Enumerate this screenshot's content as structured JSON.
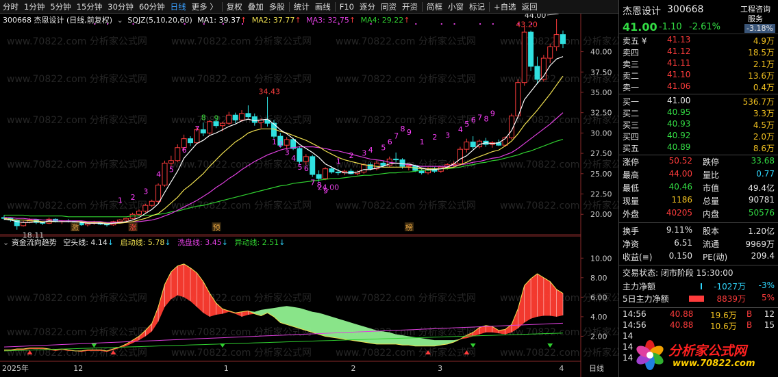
{
  "toolbar": {
    "items": [
      "分时",
      "1分钟",
      "5分钟",
      "15分钟",
      "30分钟",
      "60分钟",
      "日线",
      "更多 〉",
      "复权",
      "叠加",
      "多股",
      "统计",
      "画线",
      "F10",
      "逐分",
      "同资",
      "开资",
      "简框",
      "小窗",
      "标记",
      "+自选",
      "返回"
    ],
    "active": "日线"
  },
  "main_legend": {
    "code_name": "300668 杰恩设计 (日线,前复权)",
    "indicator": "SQJZ(5,10,20,60)",
    "ma1": "MA1: 39.37",
    "ma2": "MA2: 37.77",
    "ma3": "MA3: 32.75",
    "ma4": "MA4: 29.22",
    "colors": {
      "ma1": "#ffffff",
      "ma2": "#f0e050",
      "ma3": "#e040e0",
      "ma4": "#30d030"
    }
  },
  "sub_legend": {
    "name": "资金流向趋势",
    "l1": "空头线: 4.14",
    "l2": "启动线: 5.78",
    "l3": "洗盘线: 3.45",
    "l4": "异动线: 2.51"
  },
  "main_axis": [
    "40.00",
    "37.50",
    "35.00",
    "32.50",
    "30.00",
    "27.50",
    "25.00",
    "22.50",
    "20.00"
  ],
  "sub_axis": [
    "10.00",
    "8.00",
    "6.00",
    "4.00",
    "2.00"
  ],
  "price_labels": {
    "high1": "34.43",
    "low1": "24.00",
    "start": "18.11",
    "high2": "44.00",
    "cur": "43.20"
  },
  "digit_labels": [
    "1",
    "2",
    "3",
    "4",
    "5",
    "6",
    "7",
    "8",
    "9",
    "1",
    "2",
    "3",
    "4",
    "5",
    "6",
    "7",
    "8",
    "9",
    "1",
    "2",
    "3",
    "4",
    "5",
    "6",
    "7",
    "8",
    "9",
    "1",
    "2",
    "3",
    "4",
    "5",
    "6",
    "7",
    "8",
    "9"
  ],
  "tags": [
    "激",
    "涨",
    "预",
    "榜"
  ],
  "date_axis": [
    "2025年",
    "12",
    "1",
    "2",
    "3",
    "4"
  ],
  "period_label": "日线",
  "watermark": "www.70822.com 分析家公式网",
  "quote": {
    "name": "杰恩设计",
    "code": "300668",
    "price": "41.00",
    "change": "-1.10",
    "pct": "-2.61%",
    "sector": "工程咨询",
    "sector2": "服务",
    "sector_pct": "-3.18%",
    "asks": [
      {
        "label": "卖五 ¥",
        "price": "41.13",
        "vol": "4.9万"
      },
      {
        "label": "卖四",
        "price": "41.12",
        "vol": "18.5万"
      },
      {
        "label": "卖三",
        "price": "41.11",
        "vol": "2.1万"
      },
      {
        "label": "卖二",
        "price": "41.10",
        "vol": "13.6万"
      },
      {
        "label": "卖一",
        "price": "41.06",
        "vol": "0.4万"
      }
    ],
    "bids": [
      {
        "label": "买一",
        "price": "41.00",
        "vol": "536.7万"
      },
      {
        "label": "买二",
        "price": "40.95",
        "vol": "3.3万"
      },
      {
        "label": "买三",
        "price": "40.93",
        "vol": "4.5万"
      },
      {
        "label": "买四",
        "price": "40.92",
        "vol": "2.0万"
      },
      {
        "label": "买五",
        "price": "40.89",
        "vol": "8.6万"
      }
    ],
    "stats": [
      {
        "k1": "涨停",
        "v1": "50.52",
        "c1": "red",
        "k2": "跌停",
        "v2": "33.68",
        "c2": "green"
      },
      {
        "k1": "最高",
        "v1": "44.00",
        "c1": "red",
        "k2": "量比",
        "v2": "0.77",
        "c2": "cyan"
      },
      {
        "k1": "最低",
        "v1": "40.46",
        "c1": "green",
        "k2": "市值",
        "v2": "49.4亿",
        "c2": "white"
      },
      {
        "k1": "现量",
        "v1": "1186",
        "c1": "yellow",
        "k2": "总量",
        "v2": "90781",
        "c2": "white"
      },
      {
        "k1": "外盘",
        "v1": "40205",
        "c1": "red",
        "k2": "内盘",
        "v2": "50576",
        "c2": "green"
      },
      {
        "k1": "换手",
        "v1": "9.11%",
        "c1": "white",
        "k2": "股本",
        "v2": "1.20亿",
        "c2": "white"
      },
      {
        "k1": "净资",
        "v1": "6.51",
        "c1": "white",
        "k2": "流通",
        "v2": "9969万",
        "c2": "white"
      },
      {
        "k1": "收益(≡)",
        "v1": "0.150",
        "c1": "white",
        "k2": "PE(动)",
        "v2": "209.4",
        "c2": "white"
      }
    ],
    "trade_status": "交易状态: 闭市阶段 15:30:00",
    "flow": [
      {
        "label": "主力净额",
        "val": "-1027万",
        "pct": "-3%"
      },
      {
        "label": "5日主力净额",
        "val": "8839万",
        "pct": "5%"
      }
    ],
    "ticks": [
      {
        "t": "14:56",
        "p": "40.88",
        "v": "19.6万",
        "s": "B",
        "n": "12"
      },
      {
        "t": "14:56",
        "p": "40.88",
        "v": "10.6万",
        "s": "B",
        "n": "15"
      },
      {
        "t": "14",
        "p": "",
        "v": "",
        "s": "",
        "n": ""
      },
      {
        "t": "14",
        "p": "",
        "v": "",
        "s": "",
        "n": ""
      },
      {
        "t": "14",
        "p": "",
        "v": "",
        "s": "",
        "n": ""
      }
    ],
    "logo": {
      "cn": "分析家公式网",
      "url": "www.70822.com"
    }
  },
  "chart_data": {
    "type": "candlestick",
    "price_range": [
      18,
      44
    ],
    "sub_range": [
      0,
      11
    ],
    "candles": [
      [
        19.6,
        19.9,
        19.3,
        19.5
      ],
      [
        19.5,
        19.6,
        19.1,
        19.3
      ],
      [
        19.3,
        19.4,
        18.11,
        18.6
      ],
      [
        18.6,
        19.2,
        18.5,
        19.0
      ],
      [
        19.0,
        19.5,
        18.9,
        19.3
      ],
      [
        19.3,
        19.4,
        18.8,
        19.0
      ],
      [
        19.0,
        19.1,
        18.7,
        18.9
      ],
      [
        18.9,
        19.6,
        18.8,
        19.4
      ],
      [
        19.4,
        19.5,
        19.0,
        19.1
      ],
      [
        19.1,
        19.3,
        18.8,
        19.2
      ],
      [
        19.2,
        19.4,
        19.0,
        19.1
      ],
      [
        19.1,
        19.2,
        18.8,
        19.0
      ],
      [
        19.0,
        19.1,
        18.6,
        18.7
      ],
      [
        18.7,
        19.0,
        18.5,
        18.9
      ],
      [
        18.9,
        19.2,
        18.7,
        19.0
      ],
      [
        19.0,
        19.1,
        18.7,
        18.8
      ],
      [
        18.8,
        19.0,
        18.5,
        18.7
      ],
      [
        18.7,
        19.2,
        18.6,
        19.1
      ],
      [
        19.1,
        19.4,
        18.9,
        19.3
      ],
      [
        19.3,
        19.6,
        19.1,
        19.5
      ],
      [
        19.5,
        20.2,
        19.4,
        20.0
      ],
      [
        20.0,
        20.6,
        19.8,
        20.4
      ],
      [
        20.4,
        21.3,
        20.2,
        21.1
      ],
      [
        21.1,
        21.8,
        20.9,
        21.6
      ],
      [
        21.6,
        23.8,
        21.4,
        23.6
      ],
      [
        23.6,
        26.6,
        23.4,
        26.3
      ],
      [
        26.3,
        27.2,
        25.9,
        26.6
      ],
      [
        26.6,
        28.6,
        26.4,
        28.2
      ],
      [
        28.2,
        29.8,
        27.8,
        29.3
      ],
      [
        29.3,
        29.6,
        28.4,
        28.8
      ],
      [
        28.8,
        30.8,
        28.6,
        30.4
      ],
      [
        30.4,
        31.3,
        29.6,
        30.0
      ],
      [
        30.0,
        31.6,
        29.8,
        31.4
      ],
      [
        31.4,
        31.8,
        30.6,
        30.9
      ],
      [
        30.9,
        31.4,
        30.2,
        31.2
      ],
      [
        31.2,
        32.6,
        31.0,
        32.2
      ],
      [
        32.2,
        32.5,
        31.2,
        31.6
      ],
      [
        31.6,
        32.8,
        31.4,
        32.4
      ],
      [
        32.4,
        33.4,
        31.8,
        32.0
      ],
      [
        32.0,
        32.4,
        30.9,
        31.3
      ],
      [
        31.3,
        31.8,
        30.6,
        31.6
      ],
      [
        31.6,
        34.43,
        30.8,
        31.2
      ],
      [
        31.2,
        31.6,
        29.3,
        29.6
      ],
      [
        29.6,
        30.0,
        28.2,
        28.5
      ],
      [
        28.5,
        29.5,
        28.0,
        29.2
      ],
      [
        29.2,
        29.4,
        27.9,
        28.1
      ],
      [
        28.1,
        28.4,
        26.2,
        26.5
      ],
      [
        26.5,
        27.4,
        26.1,
        27.1
      ],
      [
        27.1,
        27.3,
        24.6,
        24.9
      ],
      [
        24.9,
        25.4,
        24.0,
        24.4
      ],
      [
        24.4,
        25.8,
        24.2,
        25.6
      ],
      [
        25.6,
        25.9,
        25.0,
        25.2
      ],
      [
        25.2,
        25.6,
        24.8,
        25.1
      ],
      [
        25.1,
        25.5,
        24.8,
        25.3
      ],
      [
        25.3,
        25.6,
        24.9,
        25.0
      ],
      [
        25.0,
        25.4,
        24.8,
        25.2
      ],
      [
        25.2,
        26.3,
        25.0,
        26.1
      ],
      [
        26.1,
        26.4,
        25.4,
        25.6
      ],
      [
        25.6,
        26.6,
        25.4,
        26.3
      ],
      [
        26.3,
        26.6,
        25.8,
        26.0
      ],
      [
        26.0,
        27.1,
        25.8,
        26.8
      ],
      [
        26.8,
        27.6,
        26.4,
        26.7
      ],
      [
        26.7,
        26.9,
        25.6,
        25.9
      ],
      [
        25.9,
        26.2,
        25.4,
        26.0
      ],
      [
        26.0,
        26.1,
        25.2,
        25.4
      ],
      [
        25.4,
        25.6,
        24.9,
        25.1
      ],
      [
        25.1,
        25.8,
        24.9,
        25.6
      ],
      [
        25.6,
        25.8,
        25.1,
        25.3
      ],
      [
        25.3,
        25.9,
        25.1,
        25.8
      ],
      [
        25.8,
        26.3,
        25.5,
        26.1
      ],
      [
        26.1,
        26.5,
        25.8,
        26.2
      ],
      [
        26.2,
        28.3,
        26.0,
        28.0
      ],
      [
        28.0,
        29.3,
        27.6,
        28.9
      ],
      [
        28.9,
        29.6,
        28.0,
        28.3
      ],
      [
        28.3,
        29.2,
        28.1,
        29.0
      ],
      [
        29.0,
        29.4,
        28.3,
        28.6
      ],
      [
        28.6,
        29.0,
        28.2,
        28.8
      ],
      [
        28.8,
        29.2,
        28.4,
        28.5
      ],
      [
        28.5,
        29.6,
        28.3,
        29.4
      ],
      [
        29.4,
        32.4,
        29.2,
        32.1
      ],
      [
        32.1,
        36.6,
        31.8,
        36.2
      ],
      [
        36.2,
        43.2,
        35.8,
        42.4
      ],
      [
        42.4,
        42.6,
        37.6,
        38.2
      ],
      [
        38.2,
        39.4,
        36.0,
        36.6
      ],
      [
        36.6,
        39.6,
        36.3,
        39.2
      ],
      [
        39.2,
        41.0,
        38.6,
        40.6
      ],
      [
        40.6,
        44.0,
        40.1,
        42.1
      ],
      [
        42.1,
        42.6,
        40.46,
        41.0
      ]
    ],
    "ma1": [
      19.4,
      19.3,
      19.1,
      19.0,
      19.0,
      19.1,
      19.0,
      19.2,
      19.1,
      19.1,
      19.1,
      19.1,
      19.0,
      18.9,
      18.9,
      18.9,
      18.8,
      18.9,
      19.0,
      19.1,
      19.3,
      19.6,
      20.1,
      20.6,
      21.3,
      22.7,
      24.0,
      25.3,
      26.9,
      27.8,
      28.7,
      29.1,
      29.7,
      30.0,
      30.4,
      30.8,
      31.1,
      31.5,
      31.7,
      31.5,
      31.6,
      31.7,
      31.1,
      30.4,
      29.9,
      29.3,
      28.6,
      28.1,
      27.6,
      27.0,
      26.2,
      25.8,
      25.4,
      25.1,
      25.1,
      25.2,
      25.5,
      25.5,
      25.7,
      25.9,
      26.2,
      26.3,
      26.2,
      26.2,
      26.0,
      25.7,
      25.5,
      25.5,
      25.6,
      25.8,
      26.2,
      26.8,
      27.2,
      27.9,
      28.6,
      28.8,
      28.7,
      28.8,
      29.3,
      30.3,
      32.0,
      34.1,
      35.1,
      36.1,
      37.0,
      38.3,
      39.1,
      39.4
    ],
    "ma2": [
      19.5,
      19.4,
      19.3,
      19.3,
      19.2,
      19.2,
      19.1,
      19.1,
      19.1,
      19.1,
      19.1,
      19.1,
      19.1,
      19.0,
      19.0,
      19.0,
      18.9,
      18.9,
      18.9,
      19.0,
      19.1,
      19.3,
      19.5,
      19.8,
      20.1,
      20.7,
      21.4,
      22.1,
      23.0,
      23.6,
      24.3,
      25.0,
      25.9,
      26.7,
      27.5,
      28.2,
      28.9,
      29.4,
      30.0,
      30.3,
      30.5,
      30.5,
      30.5,
      30.2,
      30.0,
      29.7,
      29.4,
      29.1,
      28.7,
      28.3,
      27.8,
      27.4,
      27.0,
      26.7,
      26.5,
      26.3,
      26.1,
      26.0,
      25.9,
      25.8,
      25.8,
      25.8,
      25.8,
      25.8,
      25.7,
      25.6,
      25.6,
      25.6,
      25.6,
      25.7,
      25.8,
      26.1,
      26.4,
      26.8,
      27.1,
      27.4,
      27.7,
      27.9,
      28.4,
      29.0,
      29.9,
      31.0,
      31.9,
      32.8,
      33.8,
      34.8,
      35.9,
      37.0
    ],
    "ma3": [
      19.6,
      19.6,
      19.5,
      19.5,
      19.4,
      19.4,
      19.3,
      19.3,
      19.3,
      19.2,
      19.2,
      19.2,
      19.2,
      19.1,
      19.1,
      19.1,
      19.0,
      19.0,
      19.0,
      19.0,
      19.1,
      19.1,
      19.2,
      19.3,
      19.5,
      19.8,
      20.1,
      20.5,
      20.9,
      21.3,
      21.7,
      22.2,
      22.7,
      23.3,
      23.8,
      24.4,
      24.9,
      25.5,
      26.0,
      26.5,
      26.9,
      27.3,
      27.6,
      27.9,
      28.1,
      28.2,
      28.3,
      28.3,
      28.3,
      28.2,
      28.1,
      27.9,
      27.8,
      27.6,
      27.4,
      27.2,
      27.0,
      26.8,
      26.7,
      26.6,
      26.4,
      26.3,
      26.2,
      26.1,
      26.0,
      25.9,
      25.9,
      25.9,
      25.9,
      25.9,
      26.0,
      26.1,
      26.2,
      26.4,
      26.5,
      26.7,
      26.9,
      27.0,
      27.3,
      27.6,
      28.1,
      28.7,
      29.3,
      29.9,
      30.5,
      31.1,
      31.8,
      32.5
    ],
    "ma4": [
      19.9,
      19.9,
      19.9,
      19.9,
      19.8,
      19.8,
      19.8,
      19.8,
      19.8,
      19.8,
      19.7,
      19.7,
      19.7,
      19.7,
      19.7,
      19.7,
      19.7,
      19.7,
      19.7,
      19.7,
      19.8,
      19.8,
      19.9,
      19.9,
      20.0,
      20.1,
      20.3,
      20.4,
      20.6,
      20.8,
      21.0,
      21.1,
      21.3,
      21.5,
      21.7,
      21.9,
      22.1,
      22.3,
      22.5,
      22.7,
      22.9,
      23.1,
      23.3,
      23.5,
      23.6,
      23.8,
      23.9,
      24.0,
      24.1,
      24.2,
      24.3,
      24.4,
      24.4,
      24.5,
      24.6,
      24.7,
      24.8,
      24.8,
      24.9,
      25.0,
      25.1,
      25.1,
      25.2,
      25.2,
      25.3,
      25.4,
      25.4,
      25.5,
      25.6,
      25.6,
      25.7,
      25.8,
      26.0,
      26.1,
      26.3,
      26.4,
      26.6,
      26.7,
      26.9,
      27.1,
      27.3,
      27.6,
      27.8,
      28.1,
      28.4,
      28.7,
      29.0,
      29.22
    ],
    "sub_red": [
      0.6,
      0.6,
      0.7,
      0.7,
      0.8,
      0.8,
      0.8,
      0.7,
      0.6,
      0.7,
      0.6,
      0.5,
      0.5,
      0.6,
      0.6,
      0.6,
      0.5,
      0.7,
      0.9,
      1.2,
      1.6,
      2.0,
      2.6,
      3.3,
      5.0,
      7.3,
      8.6,
      9.2,
      9.4,
      9.0,
      8.5,
      7.6,
      6.4,
      5.4,
      4.8,
      4.6,
      4.4,
      4.5,
      4.6,
      4.3,
      4.1,
      4.4,
      4.0,
      3.4,
      3.2,
      3.0,
      2.8,
      2.6,
      2.4,
      2.2,
      2.0,
      1.9,
      1.8,
      1.7,
      1.6,
      1.5,
      1.4,
      1.3,
      1.2,
      1.2,
      1.2,
      1.2,
      1.1,
      1.1,
      1.0,
      1.0,
      1.0,
      1.0,
      1.1,
      1.2,
      1.4,
      1.7,
      2.1,
      2.4,
      2.9,
      3.1,
      3.0,
      2.6,
      2.7,
      3.2,
      4.8,
      7.2,
      7.9,
      8.4,
      8.0,
      7.6,
      6.8,
      6.4
    ],
    "sub_green": [
      0.5,
      0.5,
      0.6,
      0.6,
      0.7,
      0.7,
      0.7,
      0.6,
      0.5,
      0.6,
      0.5,
      0.5,
      0.4,
      0.5,
      0.5,
      0.5,
      0.4,
      0.6,
      0.8,
      1.0,
      1.3,
      1.6,
      2.0,
      2.5,
      3.5,
      5.0,
      5.8,
      6.2,
      6.0,
      5.6,
      5.0,
      4.4,
      4.0,
      4.2,
      4.3,
      4.5,
      4.3,
      4.0,
      4.2,
      4.5,
      4.7,
      4.8,
      4.9,
      5.0,
      5.1,
      5.0,
      4.9,
      4.7,
      4.5,
      4.4,
      4.2,
      4.0,
      3.8,
      3.6,
      3.4,
      3.2,
      3.0,
      2.8,
      2.6,
      2.5,
      2.4,
      2.2,
      2.1,
      2.0,
      1.9,
      1.8,
      1.7,
      1.6,
      1.6,
      1.6,
      1.6,
      1.7,
      1.8,
      2.0,
      2.2,
      2.4,
      2.4,
      2.3,
      2.2,
      2.4,
      2.8,
      3.4,
      3.8,
      4.0,
      4.1,
      4.1,
      4.0,
      4.14
    ]
  }
}
